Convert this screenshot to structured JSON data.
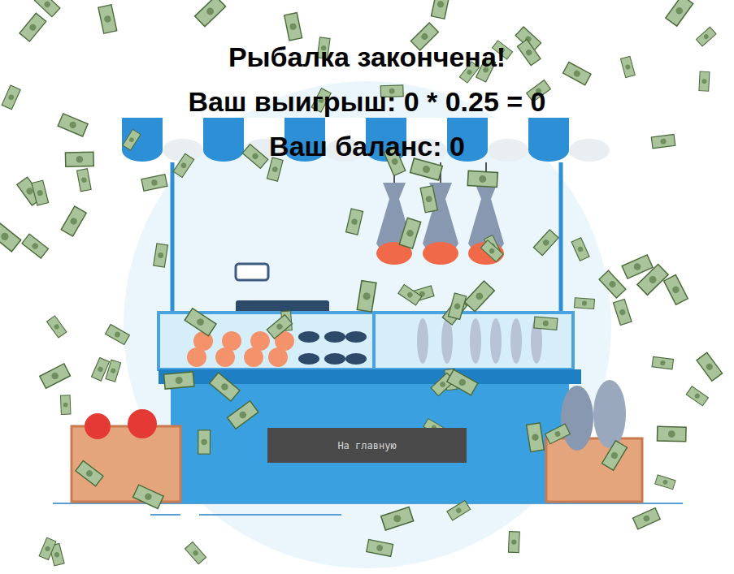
{
  "result_lines": [
    "Рыбалка закончена!",
    "Ваш выигрыш: 0 * 0.25 = 0",
    "Ваш баланс: 0"
  ],
  "buttons": [
    {
      "label": "На главную"
    }
  ]
}
